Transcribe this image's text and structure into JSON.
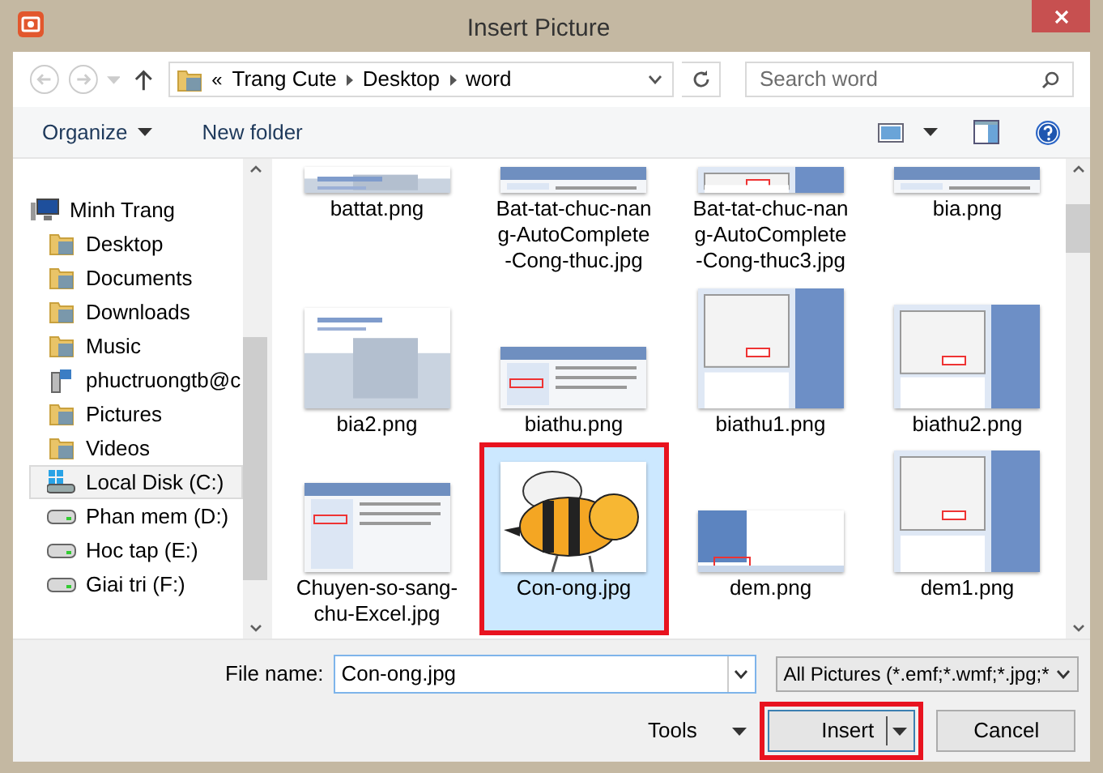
{
  "window": {
    "title": "Insert Picture"
  },
  "address": {
    "overflow": "«",
    "path": [
      "Trang Cute",
      "Desktop",
      "word"
    ]
  },
  "search": {
    "placeholder": "Search word"
  },
  "toolbar": {
    "organize": "Organize",
    "new_folder": "New folder"
  },
  "sidebar": {
    "items": [
      {
        "label": "Minh Trang",
        "kind": "computer",
        "selected": false,
        "children": [
          {
            "label": "Desktop",
            "kind": "folder",
            "selected": false
          },
          {
            "label": "Documents",
            "kind": "folder",
            "selected": false
          },
          {
            "label": "Downloads",
            "kind": "folder",
            "selected": false
          },
          {
            "label": "Music",
            "kind": "folder",
            "selected": false
          },
          {
            "label": "phuctruongtb@c",
            "kind": "phone",
            "selected": false
          },
          {
            "label": "Pictures",
            "kind": "folder",
            "selected": false
          },
          {
            "label": "Videos",
            "kind": "folder",
            "selected": false
          },
          {
            "label": "Local Disk (C:)",
            "kind": "system",
            "selected": true
          },
          {
            "label": "Phan mem (D:)",
            "kind": "drive",
            "selected": false
          },
          {
            "label": "Hoc tap (E:)",
            "kind": "drive",
            "selected": false
          },
          {
            "label": "Giai tri (F:)",
            "kind": "drive",
            "selected": false
          }
        ]
      }
    ]
  },
  "files": [
    {
      "lines": [
        "battat.png"
      ],
      "selected": false,
      "annotated": false
    },
    {
      "lines": [
        "Bat-tat-chuc-nan",
        "g-AutoComplete",
        "-Cong-thuc.jpg"
      ],
      "selected": false,
      "annotated": false
    },
    {
      "lines": [
        "Bat-tat-chuc-nan",
        "g-AutoComplete",
        "-Cong-thuc3.jpg"
      ],
      "selected": false,
      "annotated": false
    },
    {
      "lines": [
        "bia.png"
      ],
      "selected": false,
      "annotated": false
    },
    {
      "lines": [
        "bia2.png"
      ],
      "selected": false,
      "annotated": false
    },
    {
      "lines": [
        "biathu.png"
      ],
      "selected": false,
      "annotated": false
    },
    {
      "lines": [
        "biathu1.png"
      ],
      "selected": false,
      "annotated": false
    },
    {
      "lines": [
        "biathu2.png"
      ],
      "selected": false,
      "annotated": false
    },
    {
      "lines": [
        "Chuyen-so-sang-",
        "chu-Excel.jpg"
      ],
      "selected": false,
      "annotated": false
    },
    {
      "lines": [
        "Con-ong.jpg"
      ],
      "selected": true,
      "annotated": true
    },
    {
      "lines": [
        "dem.png"
      ],
      "selected": false,
      "annotated": false
    },
    {
      "lines": [
        "dem1.png"
      ],
      "selected": false,
      "annotated": false
    }
  ],
  "file_name": {
    "label": "File name:",
    "value": "Con-ong.jpg"
  },
  "file_type": {
    "value": "All Pictures (*.emf;*.wmf;*.jpg;*"
  },
  "tools": {
    "label": "Tools"
  },
  "buttons": [
    {
      "label": "Insert",
      "kind": "split",
      "annotated": true
    },
    {
      "label": "Cancel",
      "kind": "plain",
      "annotated": false
    }
  ]
}
